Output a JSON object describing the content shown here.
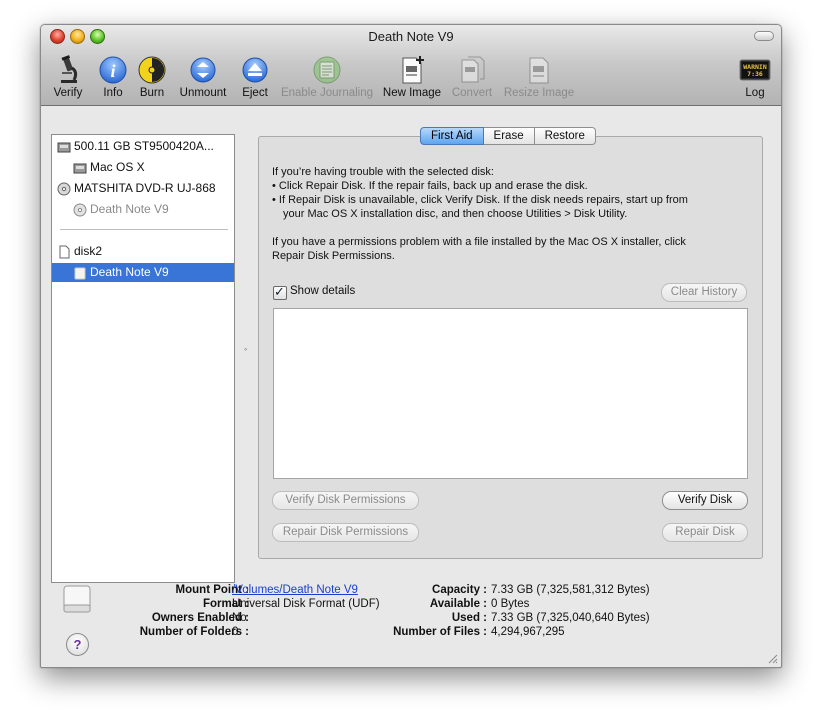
{
  "window": {
    "title": "Death Note V9"
  },
  "toolbar": {
    "items": [
      {
        "label": "Verify",
        "icon": "microscope-icon",
        "enabled": true
      },
      {
        "label": "Info",
        "icon": "info-icon",
        "enabled": true
      },
      {
        "label": "Burn",
        "icon": "burn-icon",
        "enabled": true
      },
      {
        "label": "Unmount",
        "icon": "unmount-icon",
        "enabled": true
      },
      {
        "label": "Eject",
        "icon": "eject-icon",
        "enabled": true
      },
      {
        "label": "Enable Journaling",
        "icon": "journaling-icon",
        "enabled": false
      },
      {
        "label": "New Image",
        "icon": "new-image-icon",
        "enabled": true
      },
      {
        "label": "Convert",
        "icon": "convert-icon",
        "enabled": false
      },
      {
        "label": "Resize Image",
        "icon": "resize-image-icon",
        "enabled": false
      },
      {
        "label": "Log",
        "icon": "log-icon",
        "enabled": true,
        "icon_text": "WARNIN 7:36"
      }
    ]
  },
  "sidebar": {
    "items": [
      {
        "label": "500.11 GB ST9500420A...",
        "icon": "hard-drive-icon",
        "level": 0
      },
      {
        "label": "Mac OS X",
        "icon": "volume-icon",
        "level": 1
      },
      {
        "label": "MATSHITA DVD-R UJ-868",
        "icon": "optical-drive-icon",
        "level": 0
      },
      {
        "label": "Death Note V9",
        "icon": "disc-icon",
        "level": 1,
        "dimmed": true
      },
      {
        "label": "disk2",
        "icon": "disk-image-icon",
        "level": 0
      },
      {
        "label": "Death Note V9",
        "icon": "volume-icon",
        "level": 1,
        "selected": true
      }
    ]
  },
  "tabs": [
    {
      "label": "First Aid",
      "active": true
    },
    {
      "label": "Erase",
      "active": false
    },
    {
      "label": "Restore",
      "active": false
    }
  ],
  "first_aid": {
    "intro": "If you’re having trouble with the selected disk:",
    "bullet1": "• Click Repair Disk. If the repair fails, back up and erase the disk.",
    "bullet2_line1": "• If Repair Disk is unavailable, click Verify Disk. If the disk needs repairs, start up from",
    "bullet2_line2": "your Mac OS X installation disc, and then choose Utilities > Disk Utility.",
    "perm_line1": "If you have a permissions problem with a file installed by the Mac OS X installer, click",
    "perm_line2": "Repair Disk Permissions.",
    "show_details_label": "Show details",
    "show_details_checked": true,
    "clear_history_label": "Clear History",
    "verify_permissions_label": "Verify Disk Permissions",
    "repair_permissions_label": "Repair Disk Permissions",
    "verify_disk_label": "Verify Disk",
    "repair_disk_label": "Repair Disk"
  },
  "info": {
    "mount_point_key": "Mount Point :",
    "mount_point": "/Volumes/Death Note V9",
    "format_key": "Format :",
    "format": "Universal Disk Format (UDF)",
    "owners_key": "Owners Enabled :",
    "owners": "No",
    "folders_key": "Number of Folders :",
    "folders": "0",
    "capacity_key": "Capacity :",
    "capacity": "7.33 GB (7,325,581,312 Bytes)",
    "available_key": "Available :",
    "available": "0 Bytes",
    "used_key": "Used :",
    "used": "7.33 GB (7,325,040,640 Bytes)",
    "files_key": "Number of Files :",
    "files": "4,294,967,295"
  },
  "colors": {
    "selection": "#3875d7",
    "link": "#1b3ecf",
    "tab_active": "#5ea5ef"
  }
}
